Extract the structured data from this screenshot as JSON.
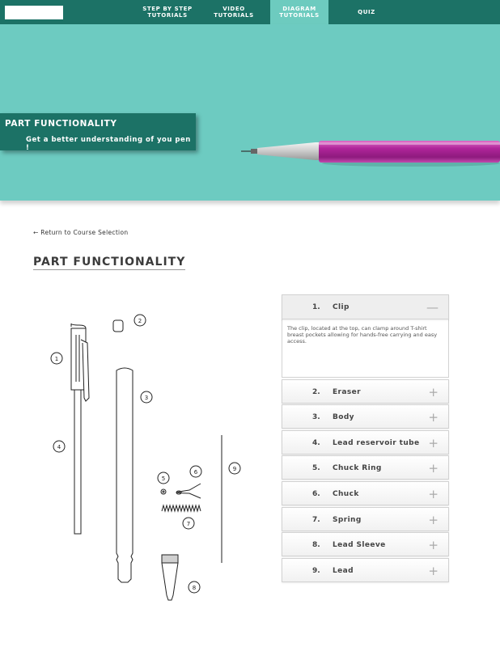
{
  "nav": {
    "items": [
      {
        "label": "STEP BY STEP\nTUTORIALS"
      },
      {
        "label": "VIDEO\nTUTORIALS"
      },
      {
        "label": "DIAGRAM\nTUTORIALS"
      },
      {
        "label": "QUIZ"
      }
    ],
    "active_index": 2,
    "active_color": "#6dcbbf",
    "bar_color": "#1c7266"
  },
  "hero": {
    "title": "PART FUNCTIONALITY",
    "subtitle": "Get a better understanding of you pen !",
    "background": "#6dcbc1"
  },
  "content": {
    "return_link": "← Return to Course Selection",
    "page_title": "PART FUNCTIONALITY"
  },
  "diagram": {
    "callouts": [
      "1",
      "2",
      "3",
      "4",
      "5",
      "6",
      "7",
      "8",
      "9"
    ]
  },
  "accordion": {
    "items": [
      {
        "num": "1.",
        "label": "Clip",
        "toggle": "—",
        "open": true,
        "description": "The clip, located at the top, can clamp around T-shirt breast pockets allowing for hands-free carrying and easy access."
      },
      {
        "num": "2.",
        "label": "Eraser",
        "toggle": "+"
      },
      {
        "num": "3.",
        "label": "Body",
        "toggle": "+"
      },
      {
        "num": "4.",
        "label": "Lead reservoir tube",
        "toggle": "+"
      },
      {
        "num": "5.",
        "label": "Chuck Ring",
        "toggle": "+"
      },
      {
        "num": "6.",
        "label": "Chuck",
        "toggle": "+"
      },
      {
        "num": "7.",
        "label": "Spring",
        "toggle": "+"
      },
      {
        "num": "8.",
        "label": "Lead Sleeve",
        "toggle": "+"
      },
      {
        "num": "9.",
        "label": "Lead",
        "toggle": "+"
      }
    ]
  }
}
